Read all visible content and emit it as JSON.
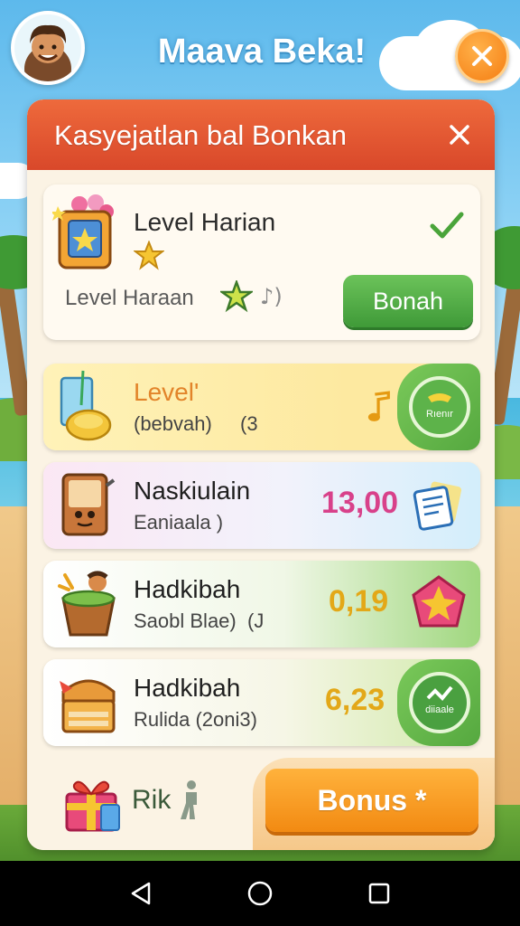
{
  "header": {
    "title": "Maava Beka!",
    "close_icon": "close-icon"
  },
  "panel": {
    "title": "Kasyejatlan bal Bonkan",
    "close_icon": "close-icon"
  },
  "daily": {
    "title": "Level Harian",
    "subtitle": "Level Haraan",
    "note": "♪)",
    "claim_label": "Bonah",
    "icon": "toy-box-icon",
    "status_icon": "checkmark-icon"
  },
  "rewards": [
    {
      "title": "Level'",
      "subtitle": "(bebvah)",
      "extra": "(3",
      "value": "",
      "badge_label": "Rıenır",
      "icon": "drink-glass-coin-icon",
      "side_icon": "music-note-icon",
      "title_color": "#e2842a",
      "value_color": "#e8a21c"
    },
    {
      "title": "Naskiulain",
      "subtitle": "Eaniaala )",
      "extra": "",
      "value": "13,00",
      "badge_label": "",
      "icon": "notebook-icon",
      "side_icon": "document-icon",
      "title_color": "#1f1f1f",
      "value_color": "#d8418a"
    },
    {
      "title": "Hadkibah",
      "subtitle": "Saobl Blae)",
      "extra": "(J",
      "value": "0,19",
      "badge_label": "",
      "icon": "bucket-icon",
      "side_icon": "gem-icon",
      "title_color": "#1f1f1f",
      "value_color": "#e3a818"
    },
    {
      "title": "Hadkibah",
      "subtitle": "Rulida (2oni3)",
      "extra": "",
      "value": "6,23",
      "badge_label": "diiaale",
      "icon": "treasure-chest-icon",
      "side_icon": "badge-icon",
      "title_color": "#1f1f1f",
      "value_color": "#e3a818"
    }
  ],
  "bonus": {
    "label": "Rik",
    "button_label": "Bonus *",
    "icon": "gift-icon"
  },
  "navbar": {
    "back_icon": "back-triangle-icon",
    "home_icon": "home-circle-icon",
    "recents_icon": "recents-square-icon"
  },
  "colors": {
    "accent_orange": "#f57d12",
    "panel_header": "#d9482a",
    "claim_green": "#3f9a38",
    "bonus_orange": "#f28a12"
  }
}
